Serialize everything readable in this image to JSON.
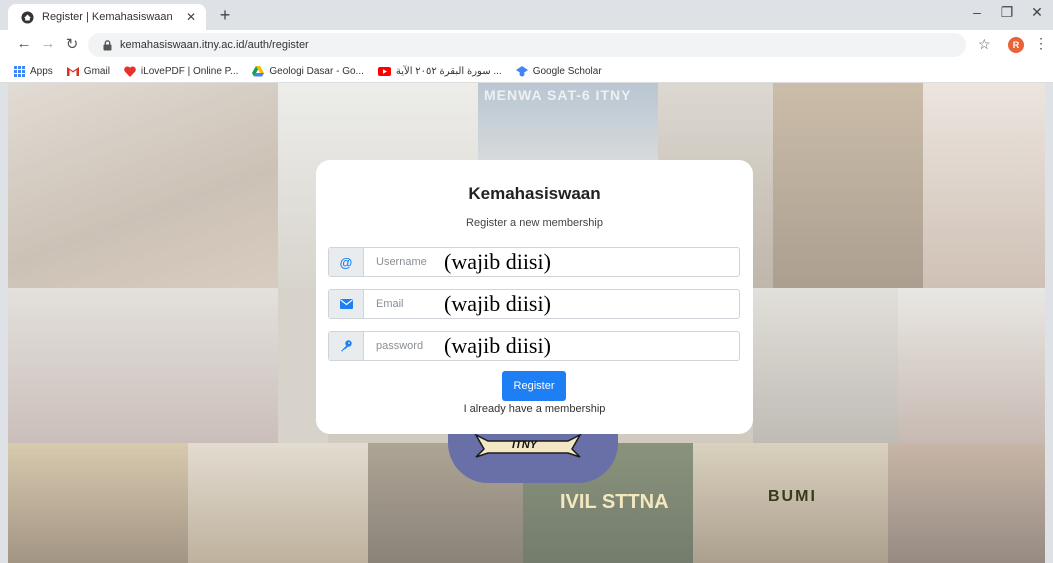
{
  "browser": {
    "tab_title": "Register | Kemahasiswaan",
    "new_tab_label": "+",
    "url": "kemahasiswaan.itny.ac.id/auth/register",
    "profile_initial": "R",
    "bookmarks": [
      {
        "label": "Apps",
        "icon": "apps-grid-icon"
      },
      {
        "label": "Gmail",
        "icon": "gmail-icon"
      },
      {
        "label": "iLovePDF | Online P...",
        "icon": "ilovepdf-icon"
      },
      {
        "label": "Geologi Dasar - Go...",
        "icon": "google-drive-icon"
      },
      {
        "label": "سورة البقرة ٢٠٥٢ الآية ...",
        "icon": "youtube-icon"
      },
      {
        "label": "Google Scholar",
        "icon": "scholar-icon"
      }
    ]
  },
  "background": {
    "menwa_text": "MENWA SAT-6 ITNY",
    "banner_text": "ITNY",
    "bumi_text": "BUMI",
    "civil_text": "IVIL STTNA"
  },
  "form": {
    "title": "Kemahasiswaan",
    "subtitle": "Register a new membership",
    "fields": [
      {
        "placeholder": "Username",
        "note": "(wajib diisi)",
        "icon": "at-sign-icon"
      },
      {
        "placeholder": "Email",
        "note": "(wajib diisi)",
        "icon": "envelope-icon"
      },
      {
        "placeholder": "password",
        "note": "(wajib diisi)",
        "icon": "key-icon"
      }
    ],
    "register_label": "Register",
    "login_link": "I already have a membership"
  },
  "colors": {
    "primary": "#1e7ff5",
    "addon_icon": "#1e7ff5"
  }
}
